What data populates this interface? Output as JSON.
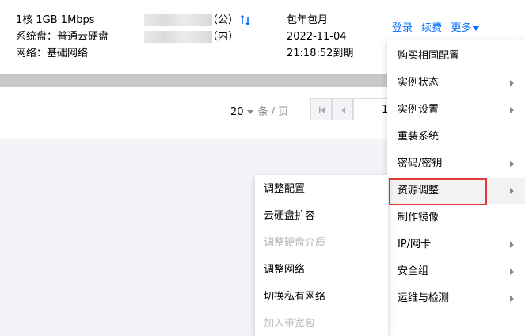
{
  "instance": {
    "spec_line1": "1核 1GB 1Mbps",
    "spec_line2": "系统盘：普通云硬盘",
    "spec_line3": "网络：基础网络",
    "ip_public_suffix": "（公）",
    "ip_private_suffix": "（内）",
    "billing_type": "包年包月",
    "expire_date": "2022-11-04",
    "expire_time": "21:18:52到期"
  },
  "actions": {
    "login": "登录",
    "renew": "续费",
    "more": "更多"
  },
  "pagination": {
    "page_size": "20",
    "page_size_unit": "条 / 页",
    "current_page": "1"
  },
  "more_menu": {
    "items": [
      {
        "label": "购买相同配置",
        "submenu": false
      },
      {
        "label": "实例状态",
        "submenu": true
      },
      {
        "label": "实例设置",
        "submenu": true
      },
      {
        "label": "重装系统",
        "submenu": false
      },
      {
        "label": "密码/密钥",
        "submenu": true
      },
      {
        "label": "资源调整",
        "submenu": true
      },
      {
        "label": "制作镜像",
        "submenu": false
      },
      {
        "label": "IP/网卡",
        "submenu": true
      },
      {
        "label": "安全组",
        "submenu": true
      },
      {
        "label": "运维与检测",
        "submenu": true
      }
    ]
  },
  "resource_submenu": {
    "items": [
      {
        "label": "调整配置",
        "disabled": false
      },
      {
        "label": "云硬盘扩容",
        "disabled": false
      },
      {
        "label": "调整硬盘介质",
        "disabled": true
      },
      {
        "label": "调整网络",
        "disabled": false
      },
      {
        "label": "切换私有网络",
        "disabled": false
      },
      {
        "label": "加入带宽包",
        "disabled": true
      }
    ]
  },
  "colors": {
    "link_blue": "#006eff",
    "highlight_red": "#e53935",
    "disabled_gray": "#b7b7b7"
  }
}
